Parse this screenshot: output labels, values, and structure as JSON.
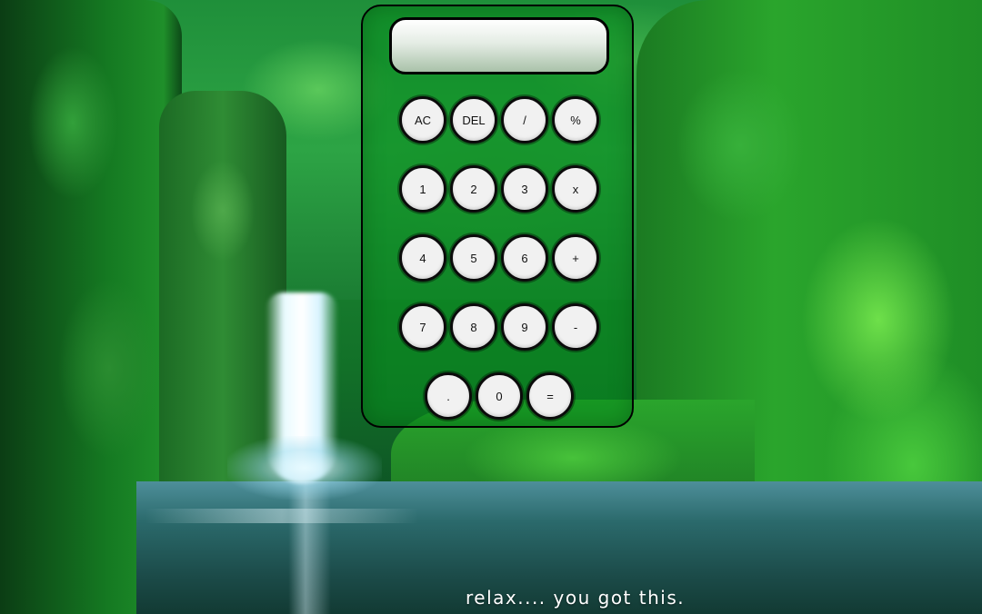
{
  "display": {
    "value": ""
  },
  "keypad": {
    "row1": [
      "AC",
      "DEL",
      "/",
      "%"
    ],
    "row2": [
      "1",
      "2",
      "3",
      "x"
    ],
    "row3": [
      "4",
      "5",
      "6",
      "+"
    ],
    "row4": [
      "7",
      "8",
      "9",
      "-"
    ],
    "row5": [
      ".",
      "0",
      "="
    ]
  },
  "footer": {
    "text": "relax.... you got this."
  },
  "colors": {
    "calculator_tint": "#088c1e",
    "key_face": "#f1f1f1",
    "key_border": "#0b0b0b",
    "footer_text": "#ffffff"
  }
}
